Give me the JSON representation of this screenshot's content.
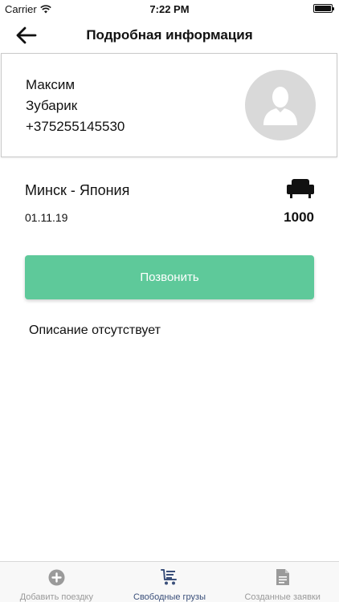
{
  "status_bar": {
    "carrier": "Carrier",
    "time": "7:22 PM"
  },
  "nav": {
    "title": "Подробная информация",
    "back_icon": "arrow-left-icon"
  },
  "contact": {
    "first_name": "Максим",
    "last_name": "Зубарик",
    "phone": "+375255145530",
    "avatar_icon": "person-silhouette-icon"
  },
  "trip": {
    "route": "Минск - Япония",
    "date": "01.11.19",
    "price": "1000",
    "seat_icon": "armchair-icon"
  },
  "call_button": {
    "label": "Позвонить",
    "color": "#5ec99a"
  },
  "description": "Описание отсутствует",
  "tabs": [
    {
      "label": "Добавить поездку",
      "icon": "plus-circle-icon",
      "active": false
    },
    {
      "label": "Свободные грузы",
      "icon": "cart-list-icon",
      "active": true
    },
    {
      "label": "Созданные заявки",
      "icon": "document-icon",
      "active": false
    }
  ],
  "colors": {
    "accent": "#5ec99a",
    "active_tab": "#3a4f7a",
    "inactive_tab": "#9a9a9a"
  }
}
